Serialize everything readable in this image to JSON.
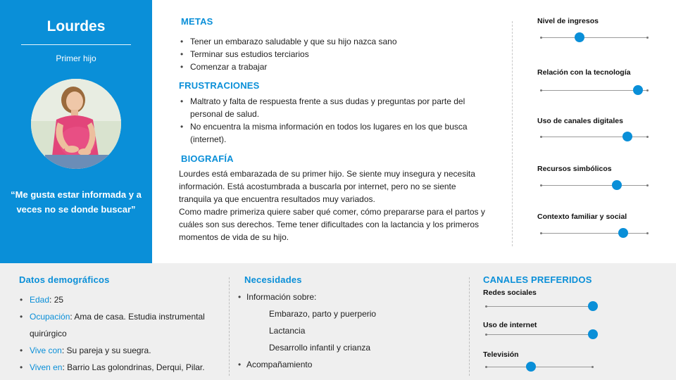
{
  "persona": {
    "name": "Lourdes",
    "subtitle": "Primer hijo",
    "quote": "“Me gusta estar informada y a veces no se donde buscar”",
    "accent_color": "#0a8fd8"
  },
  "metas": {
    "title": "METAS",
    "items": [
      "Tener un embarazo saludable y que su hijo nazca sano",
      "Terminar sus estudios terciarios",
      "Comenzar a trabajar"
    ]
  },
  "frustraciones": {
    "title": "FRUSTRACIONES",
    "items": [
      "Maltrato y falta de respuesta frente a sus dudas y preguntas por parte del personal de salud.",
      "No encuentra la misma información en todos los lugares en los que busca (internet)."
    ]
  },
  "biografia": {
    "title": "BIOGRAFÍA",
    "paragraphs": [
      "Lourdes está embarazada de su primer hijo. Se siente muy insegura y necesita información. Está acostumbrada a buscarla por internet, pero no se siente tranquila ya que encuentra resultados muy variados.",
      "Como madre primeriza quiere saber qué comer, cómo prepararse para el partos y cuáles son sus derechos. Teme tener dificultades con la lactancia y los primeros momentos de vida de su hijo."
    ]
  },
  "sliders": [
    {
      "label": "Nivel de ingresos",
      "level": 0.36
    },
    {
      "label": "Relación con la tecnología",
      "level": 0.91
    },
    {
      "label": "Uso de canales digitales",
      "level": 0.81
    },
    {
      "label": "Recursos simbólicos",
      "level": 0.71
    },
    {
      "label": "Contexto familiar y social",
      "level": 0.77
    }
  ],
  "demograficos": {
    "title": "Datos demográficos",
    "items": [
      {
        "key": "Edad",
        "value": ": 25"
      },
      {
        "key": "Ocupación",
        "value": ": Ama de casa. Estudia instrumental quirúrgico"
      },
      {
        "key": "Vive con",
        "value": ": Su pareja y su suegra."
      },
      {
        "key": "Viven en",
        "value": ": Barrio Las golondrinas, Derqui, Pilar."
      }
    ]
  },
  "necesidades": {
    "title": "Necesidades",
    "intro": "Información sobre:",
    "subitems": [
      "Embarazo, parto y puerperio",
      "Lactancia",
      "Desarrollo infantil y crianza"
    ],
    "last": "Acompañamiento"
  },
  "canales": {
    "title": "CANALES PREFERIDOS",
    "items": [
      {
        "label": "Redes sociales",
        "level": 1.0
      },
      {
        "label": "Uso de internet",
        "level": 1.0
      },
      {
        "label": "Televisión",
        "level": 0.42
      }
    ]
  }
}
